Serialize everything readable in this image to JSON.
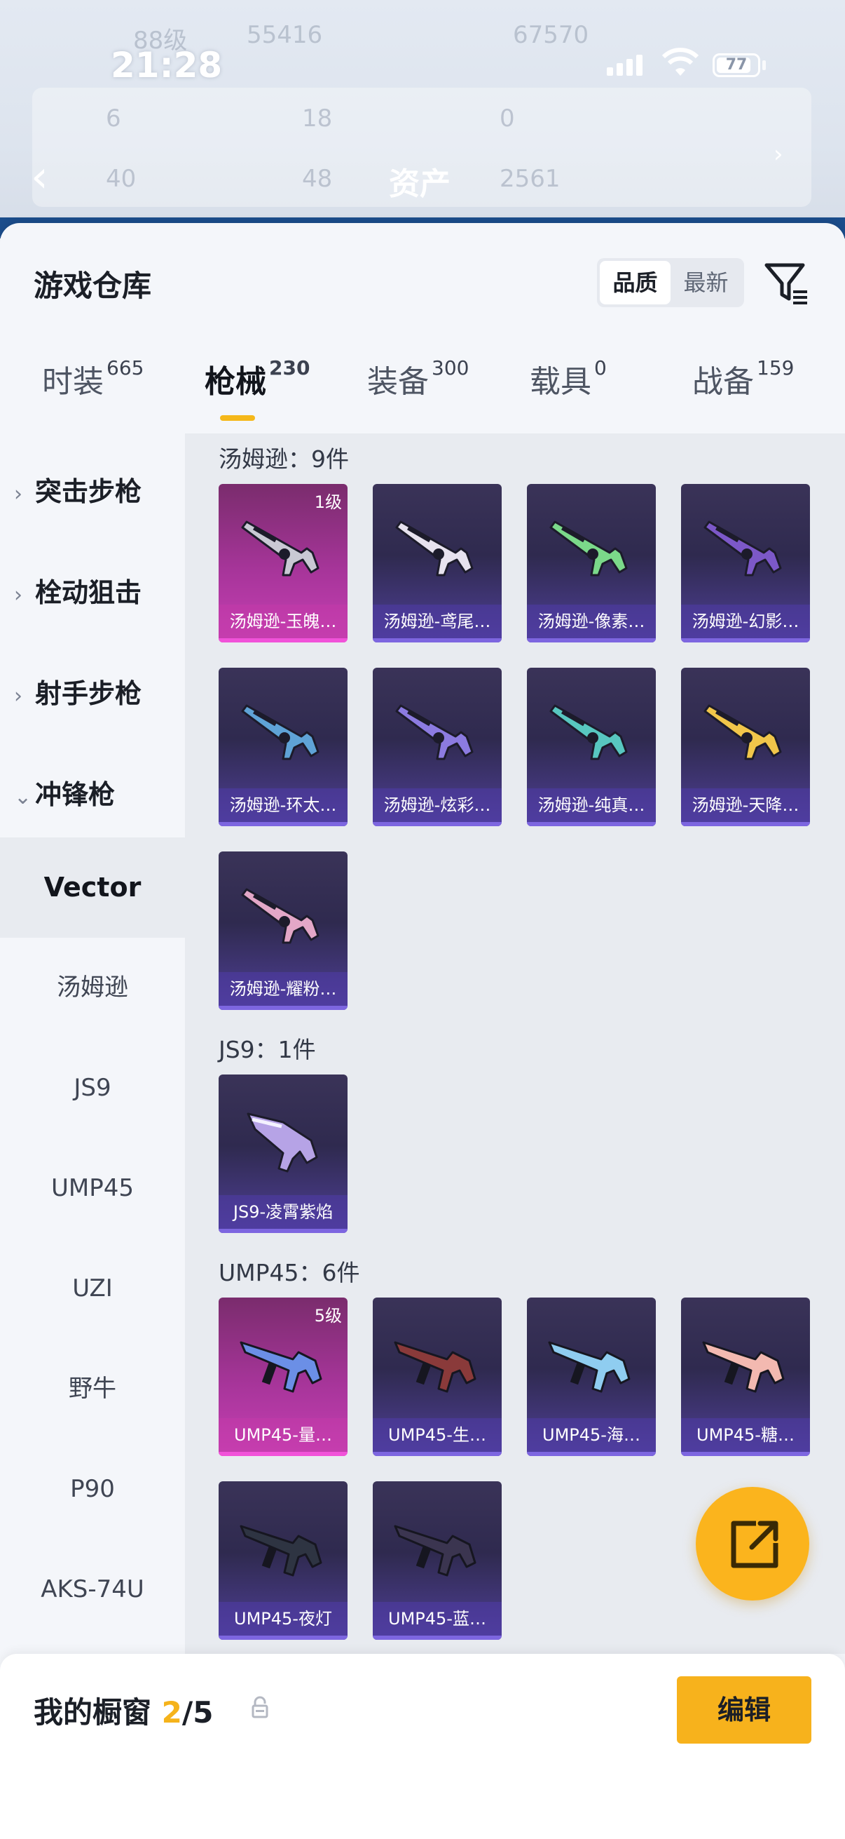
{
  "status": {
    "time": "21:28",
    "battery": "77"
  },
  "header": {
    "title": "资产",
    "blur_texts": [
      "88级",
      "55416",
      "67570"
    ],
    "stats": [
      "6",
      "18",
      "0",
      "40",
      "48",
      "2561"
    ]
  },
  "warehouse": {
    "title": "游戏仓库",
    "sort_options": [
      "品质",
      "最新"
    ],
    "sort_selected": "品质"
  },
  "tabs": [
    {
      "label": "时装",
      "count": "665"
    },
    {
      "label": "枪械",
      "count": "230"
    },
    {
      "label": "装备",
      "count": "300"
    },
    {
      "label": "载具",
      "count": "0"
    },
    {
      "label": "战备",
      "count": "159"
    }
  ],
  "sidebar": {
    "categories": [
      {
        "label": "突击步枪",
        "chev": "›"
      },
      {
        "label": "栓动狙击",
        "chev": "›"
      },
      {
        "label": "射手步枪",
        "chev": "›"
      },
      {
        "label": "冲锋枪",
        "chev": "⌄"
      }
    ],
    "subitems": [
      "Vector",
      "汤姆逊",
      "JS9",
      "UMP45",
      "UZI",
      "野牛",
      "P90",
      "AKS-74U"
    ]
  },
  "groups": [
    {
      "header": "汤姆逊：9件",
      "items": [
        {
          "name": "汤姆逊-玉魄…",
          "level": "1级",
          "rarity": "pink",
          "gun": "tommy",
          "color": "#c9c9d4"
        },
        {
          "name": "汤姆逊-鸢尾…",
          "level": "",
          "rarity": "purple",
          "gun": "tommy",
          "color": "#e7e2ee"
        },
        {
          "name": "汤姆逊-像素…",
          "level": "",
          "rarity": "purple",
          "gun": "tommy",
          "color": "#7bd98a"
        },
        {
          "name": "汤姆逊-幻影…",
          "level": "",
          "rarity": "purple",
          "gun": "tommy",
          "color": "#7c58c8"
        },
        {
          "name": "汤姆逊-环太…",
          "level": "",
          "rarity": "purple",
          "gun": "tommy",
          "color": "#5fa3d6"
        },
        {
          "name": "汤姆逊-炫彩…",
          "level": "",
          "rarity": "purple",
          "gun": "tommy",
          "color": "#8c7be0"
        },
        {
          "name": "汤姆逊-纯真…",
          "level": "",
          "rarity": "purple",
          "gun": "tommy",
          "color": "#58c7c0"
        },
        {
          "name": "汤姆逊-天降…",
          "level": "",
          "rarity": "purple",
          "gun": "tommy",
          "color": "#f1c64a"
        },
        {
          "name": "汤姆逊-耀粉…",
          "level": "",
          "rarity": "purple",
          "gun": "tommy",
          "color": "#e3a7c7"
        }
      ]
    },
    {
      "header": "JS9：1件",
      "items": [
        {
          "name": "JS9-凌霄紫焰",
          "level": "",
          "rarity": "purple",
          "gun": "js9",
          "color": "#b6a3e6"
        }
      ]
    },
    {
      "header": "UMP45：6件",
      "items": [
        {
          "name": "UMP45-量…",
          "level": "5级",
          "rarity": "pink",
          "gun": "ump",
          "color": "#6b8fe6"
        },
        {
          "name": "UMP45-生…",
          "level": "",
          "rarity": "purple",
          "gun": "ump",
          "color": "#8a3a3a"
        },
        {
          "name": "UMP45-海…",
          "level": "",
          "rarity": "purple",
          "gun": "ump",
          "color": "#8fcdf0"
        },
        {
          "name": "UMP45-糖…",
          "level": "",
          "rarity": "purple",
          "gun": "ump",
          "color": "#f3b9b0"
        },
        {
          "name": "UMP45-夜灯",
          "level": "",
          "rarity": "purple",
          "gun": "ump",
          "color": "#2e3442"
        },
        {
          "name": "UMP45-蓝…",
          "level": "",
          "rarity": "purple",
          "gun": "ump",
          "color": "#3b3550"
        }
      ]
    }
  ],
  "showcase": {
    "label": "我的橱窗",
    "current": "2",
    "total": "/5",
    "edit_label": "编辑"
  }
}
